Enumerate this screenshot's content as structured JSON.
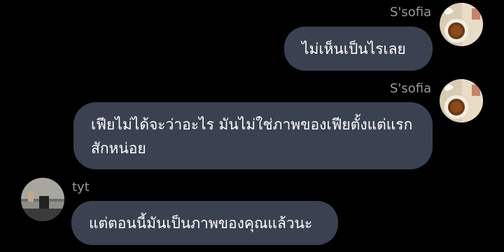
{
  "messages": [
    {
      "sender": "S'sofia",
      "side": "right",
      "avatar_icon": "tea-cup-book-avatar",
      "text": "ไม่เห็นเป็นไรเลย"
    },
    {
      "sender": "S'sofia",
      "side": "right",
      "avatar_icon": "tea-cup-book-avatar",
      "text": "เฟียไม่ได้จะว่าอะไร มันไม่ใช่ภาพของเฟียตั้งแต่แรกสักหน่อย"
    },
    {
      "sender": "tyt",
      "side": "left",
      "avatar_icon": "street-photo-avatar",
      "text": "แต่ตอนนี้มันเป็นภาพของคุณแล้วนะ"
    }
  ],
  "colors": {
    "background": "#000000",
    "bubble": "#3a4150",
    "bubble_text": "#ffffff",
    "sender_name": "#9a9a9a"
  }
}
